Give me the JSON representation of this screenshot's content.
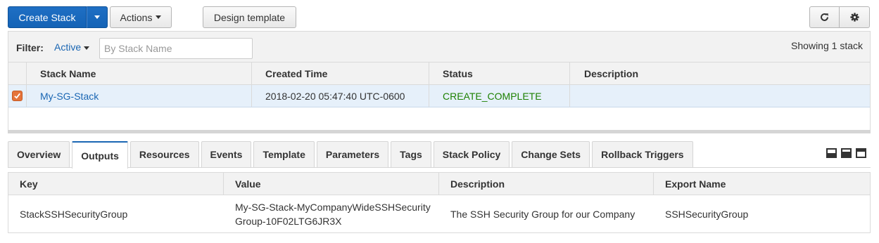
{
  "toolbar": {
    "create_stack_label": "Create Stack",
    "actions_label": "Actions",
    "design_template_label": "Design template",
    "refresh_icon": "refresh-icon",
    "settings_icon": "gear-icon"
  },
  "filter": {
    "label": "Filter:",
    "status_value": "Active",
    "search_placeholder": "By Stack Name",
    "showing_text": "Showing 1 stack"
  },
  "stacks_table": {
    "columns": [
      "Stack Name",
      "Created Time",
      "Status",
      "Description"
    ],
    "rows": [
      {
        "selected": true,
        "stack_name": "My-SG-Stack",
        "created_time": "2018-02-20 05:47:40 UTC-0600",
        "status": "CREATE_COMPLETE",
        "description": ""
      }
    ]
  },
  "tabs": [
    {
      "label": "Overview",
      "active": false
    },
    {
      "label": "Outputs",
      "active": true
    },
    {
      "label": "Resources",
      "active": false
    },
    {
      "label": "Events",
      "active": false
    },
    {
      "label": "Template",
      "active": false
    },
    {
      "label": "Parameters",
      "active": false
    },
    {
      "label": "Tags",
      "active": false
    },
    {
      "label": "Stack Policy",
      "active": false
    },
    {
      "label": "Change Sets",
      "active": false
    },
    {
      "label": "Rollback Triggers",
      "active": false
    }
  ],
  "outputs_table": {
    "columns": [
      "Key",
      "Value",
      "Description",
      "Export Name"
    ],
    "rows": [
      {
        "key": "StackSSHSecurityGroup",
        "value": "My-SG-Stack-MyCompanyWideSSHSecurityGroup-10F02LTG6JR3X",
        "description": "The SSH Security Group for our Company",
        "export_name": "SSHSecurityGroup"
      }
    ]
  },
  "colors": {
    "primary": "#1463b6",
    "link": "#1a66b3",
    "status_complete": "#1d8102",
    "selected_row": "#e6f0fa",
    "checkbox": "#e5733a"
  }
}
